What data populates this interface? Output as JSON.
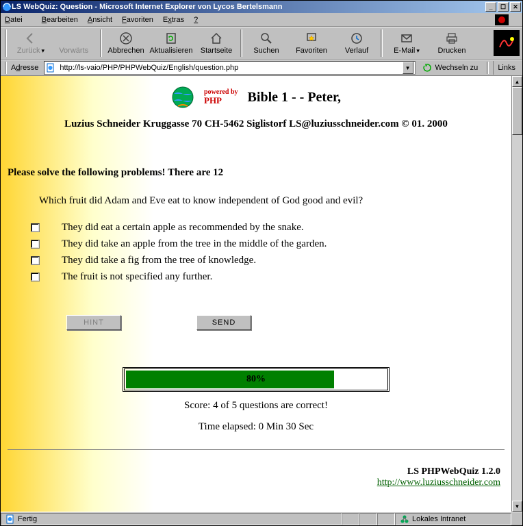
{
  "window": {
    "title": "LS WebQuiz: Question - Microsoft Internet Explorer von Lycos Bertelsmann"
  },
  "menubar": {
    "items": [
      "Datei",
      "Bearbeiten",
      "Ansicht",
      "Favoriten",
      "Extras",
      "?"
    ]
  },
  "toolbar": {
    "back": "Zurück",
    "forward": "Vorwärts",
    "stop": "Abbrechen",
    "refresh": "Aktualisieren",
    "home": "Startseite",
    "search": "Suchen",
    "favorites": "Favoriten",
    "history": "Verlauf",
    "mail": "E-Mail",
    "print": "Drucken"
  },
  "addressbar": {
    "label": "Adresse",
    "url": "http://ls-vaio/PHP/PHPWebQuiz/English/question.php",
    "go": "Wechseln zu",
    "links": "Links"
  },
  "page": {
    "powered_by_1": "powered by",
    "powered_by_2": "PHP",
    "title": "Bible 1 - - Peter,",
    "byline": "Luzius Schneider Kruggasse 70 CH-5462 Siglistorf LS@luziusschneider.com © 01. 2000",
    "instruction": "Please solve the following problems! There are 12",
    "question": "Which fruit did Adam and Eve eat to know independent of God good and evil?",
    "answers": [
      "They did eat a certain apple as recommended by the snake.",
      "They did take an apple from the tree in the middle of the garden.",
      "They did take a fig from the tree of knowledge.",
      "The fruit is not specified any further."
    ],
    "hint_btn": "HINT",
    "send_btn": "SEND",
    "progress_pct": 80,
    "progress_label": "80%",
    "score": "Score: 4 of 5 questions are correct!",
    "elapsed": "Time elapsed: 0 Min 30 Sec",
    "footer_product": "LS PHPWebQuiz 1.2.0",
    "footer_link": "http://www.luziusschneider.com"
  },
  "statusbar": {
    "status": "Fertig",
    "zone": "Lokales Intranet"
  }
}
